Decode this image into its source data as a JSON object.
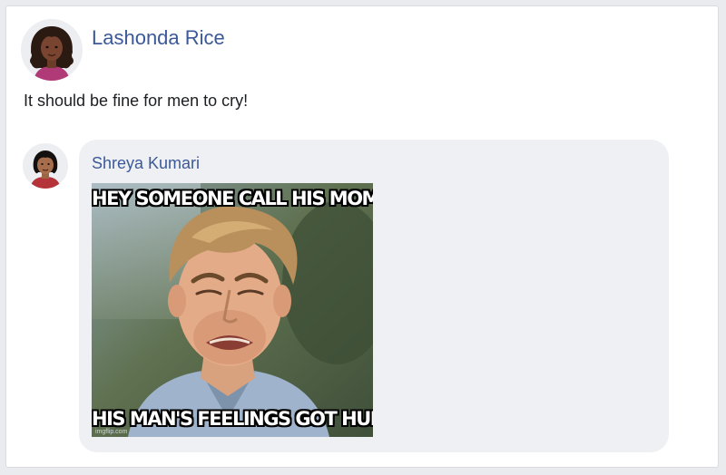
{
  "post": {
    "author": "Lashonda Rice",
    "text": "It should be fine for men to cry!"
  },
  "comment": {
    "author": "Shreya Kumari",
    "meme": {
      "top_text": "HEY SOMEONE CALL HIS MOM",
      "bottom_text": "HIS MAN'S FEELINGS GOT HURT",
      "watermark": "imgflip.com"
    }
  },
  "colors": {
    "name_link": "#3b5998",
    "bubble": "#eff0f3",
    "page_bg": "#e9ebee"
  }
}
